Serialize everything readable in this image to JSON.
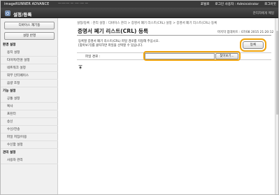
{
  "topbar": {
    "brand": "imageRUNNER ADVANCE",
    "device_name": "—·—·— — ·— ·— —",
    "portal_label": "포털로",
    "login_user": "로그인 사용자 : Administrator",
    "logout_label": "로그아웃"
  },
  "header": {
    "title": "설정/등록",
    "admin_contact": "관리자에게 메일"
  },
  "sidebar": {
    "device_manage_button": "디바이스 재기동",
    "apply_settings_button": "설정 반영",
    "sections": [
      {
        "label": "환경 설정",
        "items": [
          "용지 설정",
          "타이머/전원 설정",
          "네트워크 설정",
          "외부 인터페이스",
          "음량 조정"
        ]
      },
      {
        "label": "기능 설정",
        "items": [
          "공통 설정",
          "복사",
          "프린터",
          "송신",
          "수신/전송",
          "파일 저장/이용",
          "수신함 설정"
        ]
      },
      {
        "label": "관리 설정",
        "items": [
          "사용자 관리"
        ]
      }
    ]
  },
  "main": {
    "breadcrumb": "설정/등록 : 관리 설정 : 디바이스 관리 > 증명서 폐기 리스트(CRL) 설정 > 증명서 폐기 리스트(CRL) 등록",
    "page_title": "증명서 폐기 리스트(CRL) 등록",
    "last_updated": "마지막 업데이트 : 07/08 2015 21:20:12",
    "description_line1": "등록할 증명서 폐기 리스트(CRL) 파일 경로를 지정해 주십시오.",
    "description_line2": "[찾아보기]를 클릭하면 파일을 선택할 수 있습니다.",
    "register_button": "등록",
    "file_path_label": "파일 경로 :",
    "file_path_value": "",
    "browse_button": "찾아보기..."
  },
  "colors": {
    "highlight": "#f0a30a",
    "topbar": "#3a3a3a",
    "ribbon": "#353535"
  }
}
